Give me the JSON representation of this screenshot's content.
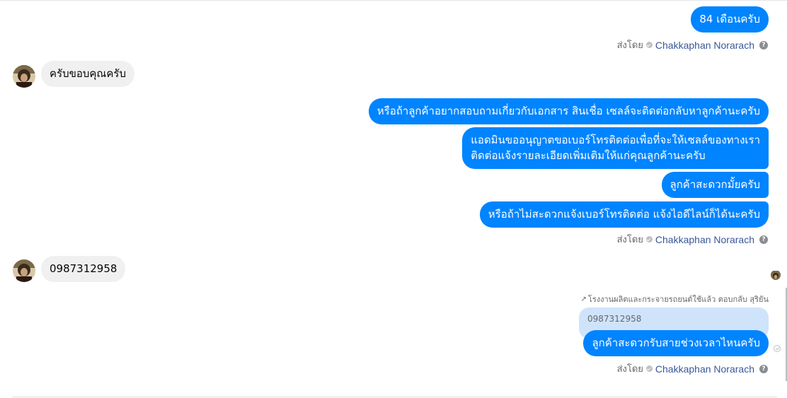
{
  "colors": {
    "outgoing_bubble": "#0084ff",
    "incoming_bubble": "#f0f0f0",
    "agent_link": "#385898"
  },
  "sender_label": "ส่งโดย",
  "agent_name": "Chakkaphan Norarach",
  "messages": {
    "m1": "84 เดือนครับ",
    "m2": "ครับขอบคุณครับ",
    "m3": "หรือถ้าลูกค้าอยากสอบถามเกี่ยวกับเอกสาร สินเชื่อ เซลล์จะติดต่อกลับหาลูกค้านะครับ",
    "m4_line1": "แอดมินขออนุญาตขอเบอร์โทรติดต่อเพื่อที่จะให้เซลล์ของทางเรา",
    "m4_line2": "ติดต่อแจ้งรายละเอียดเพิ่มเติมให้แก่คุณลูกค้านะครับ",
    "m5": "ลูกค้าสะดวกมั้ยครับ",
    "m6": "หรือถ้าไม่สะดวกแจ้งเบอร์โทรติดต่อ แจ้งไอดีไลน์ก็ได้นะครับ",
    "m7": "0987312958",
    "reply_header": "โรงงานผลิตและกระจายรถยนต์ใช้แล้ว ตอบกลับ สุริยัน",
    "reply_quote": "0987312958",
    "m8": "ลูกค้าสะดวกรับสายช่วงเวลาไหนครับ"
  },
  "icons": {
    "check": "check-circle-icon",
    "help": "question-icon",
    "reply": "reply-arrow-icon",
    "seen": "seen-check-icon"
  }
}
